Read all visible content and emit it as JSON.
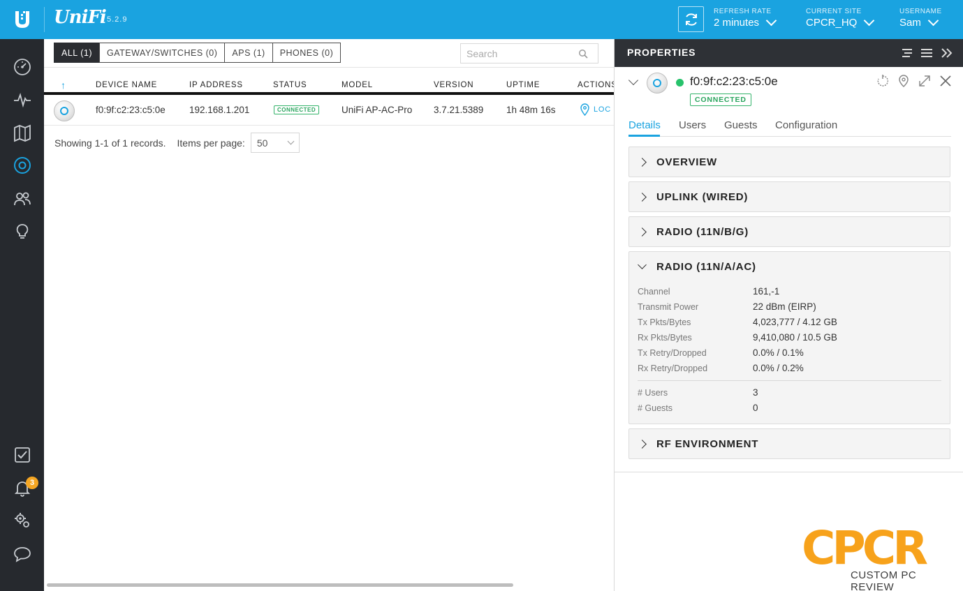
{
  "topbar": {
    "brand": "UniFi",
    "version": "5.2.9",
    "refresh": {
      "label": "REFRESH RATE",
      "value": "2 minutes"
    },
    "site": {
      "label": "CURRENT SITE",
      "value": "CPCR_HQ"
    },
    "user": {
      "label": "USERNAME",
      "value": "Sam"
    },
    "color": "#1aa3e0"
  },
  "sidebar": {
    "items": [
      {
        "name": "dashboard",
        "icon": "speedometer-icon"
      },
      {
        "name": "statistics",
        "icon": "pulse-icon"
      },
      {
        "name": "map",
        "icon": "map-icon"
      },
      {
        "name": "devices",
        "icon": "device-ring-icon",
        "active": true
      },
      {
        "name": "clients",
        "icon": "users-icon"
      },
      {
        "name": "insights",
        "icon": "lightbulb-icon"
      }
    ],
    "bottom": [
      {
        "name": "events",
        "icon": "checkbox-icon"
      },
      {
        "name": "alerts",
        "icon": "bell-icon",
        "badge": "3"
      },
      {
        "name": "settings",
        "icon": "gears-icon"
      },
      {
        "name": "chat",
        "icon": "chat-bubble-icon"
      }
    ]
  },
  "filters": {
    "all": "ALL (1)",
    "gateway": "GATEWAY/SWITCHES (0)",
    "aps": "APS (1)",
    "phones": "PHONES (0)"
  },
  "search": {
    "placeholder": "Search"
  },
  "table": {
    "sort_arrow": "↑",
    "columns": {
      "device_name": "DEVICE NAME",
      "ip": "IP ADDRESS",
      "status": "STATUS",
      "model": "MODEL",
      "version": "VERSION",
      "uptime": "UPTIME",
      "actions": "ACTIONS"
    },
    "rows": [
      {
        "device_name": "f0:9f:c2:23:c5:0e",
        "ip": "192.168.1.201",
        "status": "CONNECTED",
        "model": "UniFi AP-AC-Pro",
        "version": "3.7.21.5389",
        "uptime": "1h 48m 16s",
        "action": "LOC"
      }
    ]
  },
  "paging": {
    "showing": "Showing 1-1 of 1 records.",
    "items_label": "Items per page:",
    "items_value": "50"
  },
  "properties": {
    "title": "PROPERTIES",
    "device_name": "f0:9f:c2:23:c5:0e",
    "status": "CONNECTED",
    "tabs": {
      "details": "Details",
      "users": "Users",
      "guests": "Guests",
      "configuration": "Configuration"
    },
    "sections": {
      "overview": "OVERVIEW",
      "uplink": "UPLINK (WIRED)",
      "radio_bg": "RADIO (11N/B/G)",
      "radio_ac": "RADIO (11N/A/AC)",
      "rf": "RF ENVIRONMENT"
    },
    "radio_ac": {
      "rows": [
        {
          "k": "Channel",
          "v": "161,-1"
        },
        {
          "k": "Transmit Power",
          "v": "22 dBm (EIRP)"
        },
        {
          "k": "Tx Pkts/Bytes",
          "v": "4,023,777 / 4.12 GB"
        },
        {
          "k": "Rx Pkts/Bytes",
          "v": "9,410,080 / 10.5 GB"
        },
        {
          "k": "Tx Retry/Dropped",
          "v": "0.0% / 0.1%"
        },
        {
          "k": "Rx Retry/Dropped",
          "v": "0.0% / 0.2%"
        }
      ],
      "rows2": [
        {
          "k": "# Users",
          "v": "3"
        },
        {
          "k": "# Guests",
          "v": "0"
        }
      ]
    }
  },
  "watermark": {
    "letters": "CPCR",
    "sub": "CUSTOM PC REVIEW"
  }
}
